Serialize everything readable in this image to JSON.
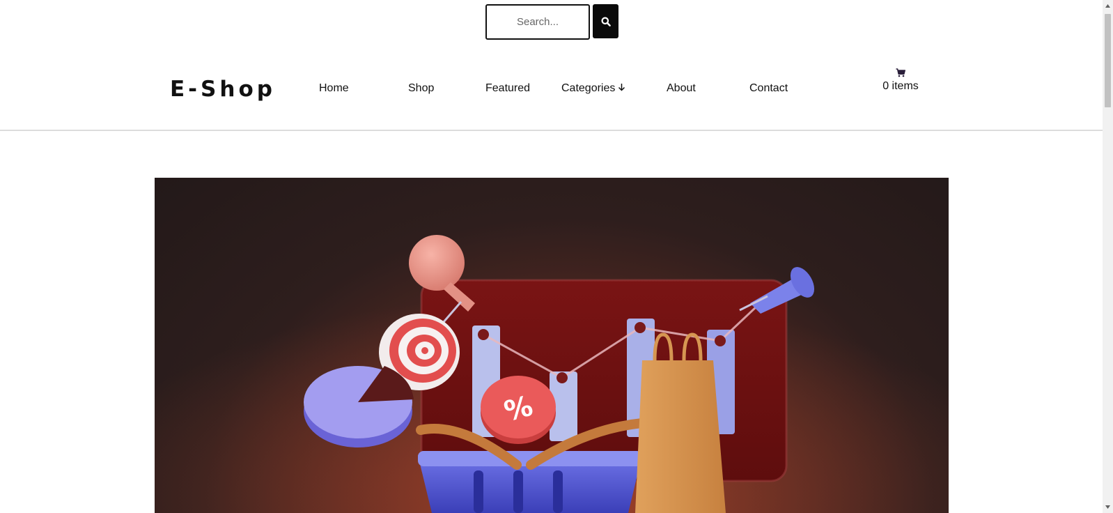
{
  "search": {
    "placeholder": "Search..."
  },
  "header": {
    "logo": "E-Shop",
    "nav": {
      "home": "Home",
      "shop": "Shop",
      "featured": "Featured",
      "categories": "Categories",
      "about": "About",
      "contact": "Contact"
    },
    "cart": {
      "icon": "cart-icon",
      "label": "0 items"
    }
  },
  "hero": {
    "image": "shopping-marketing-3d-illustration"
  },
  "icons": {
    "search": "search-icon",
    "categories_arrow": "arrow-down-icon"
  },
  "colors": {
    "brand_dark": "#0a0a0a",
    "hero_bg": "#2e1e1d",
    "divider": "#dcdcdc"
  }
}
